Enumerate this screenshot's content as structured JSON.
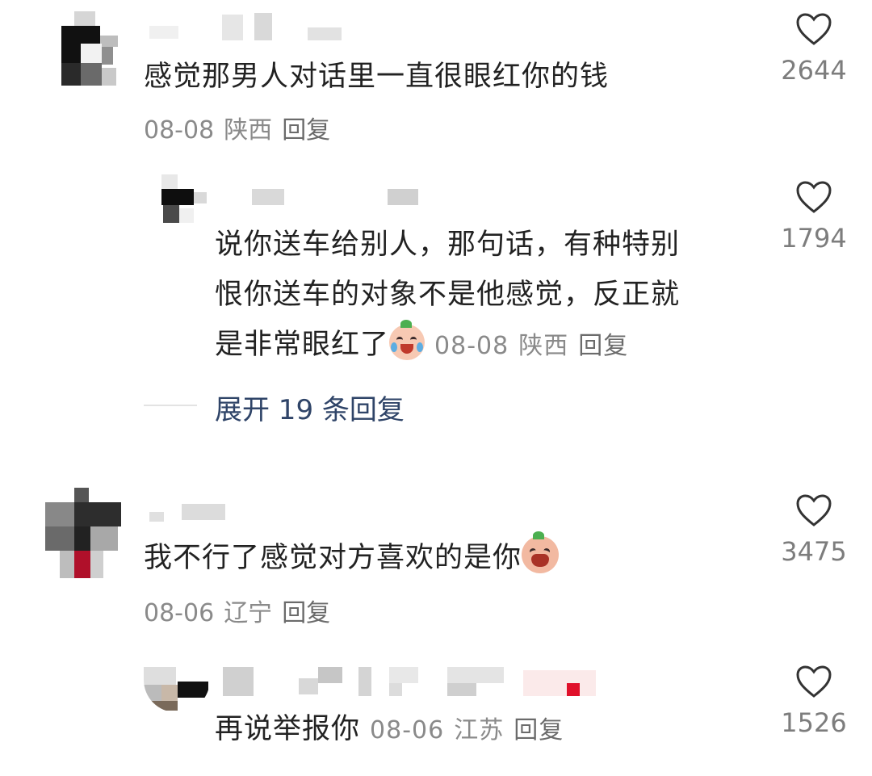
{
  "comments": [
    {
      "text": "感觉那男人对话里一直很眼红你的钱",
      "date": "08-08",
      "location": "陕西",
      "reply_label": "回复",
      "likes": "2644",
      "replies": [
        {
          "text_line1": "说你送车给别人，那句话，有种特别",
          "text_line2": "恨你送车的对象不是他感觉，反正就",
          "text_line3": "是非常眼红了",
          "emoji_icon": "crying-peach-emoji-icon",
          "date": "08-08",
          "location": "陕西",
          "reply_label": "回复",
          "likes": "1794"
        }
      ],
      "expand_label": "展开 19 条回复"
    },
    {
      "text": "我不行了感觉对方喜欢的是你",
      "emoji_icon": "screaming-peach-emoji-icon",
      "date": "08-06",
      "location": "辽宁",
      "reply_label": "回复",
      "likes": "3475",
      "replies": [
        {
          "text": "再说举报你",
          "date": "08-06",
          "location": "江苏",
          "reply_label": "回复",
          "likes": "1526"
        }
      ]
    }
  ],
  "icons": {
    "like": "heart-outline-icon"
  },
  "colors": {
    "text": "#222222",
    "meta": "#8a8a8a",
    "expand": "#2f4468",
    "like_count": "#7d7d7d"
  }
}
